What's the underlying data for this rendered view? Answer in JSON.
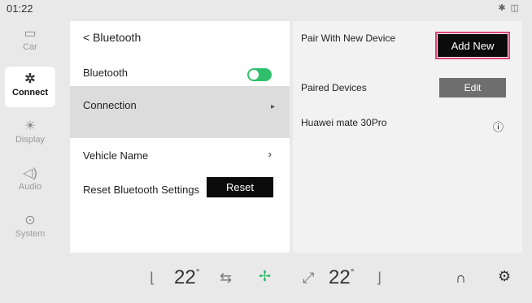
{
  "status": {
    "time": "01:22"
  },
  "sidebar": {
    "items": [
      {
        "label": "Car",
        "icon": "car-icon"
      },
      {
        "label": "Connect",
        "icon": "connect-icon"
      },
      {
        "label": "Display",
        "icon": "brightness-icon"
      },
      {
        "label": "Audio",
        "icon": "speaker-icon"
      },
      {
        "label": "System",
        "icon": "system-icon"
      }
    ]
  },
  "bluetooth_panel": {
    "back_label": "<  Bluetooth",
    "bluetooth_label": "Bluetooth",
    "bluetooth_on": true,
    "connection_label": "Connection",
    "vehicle_name_label": "Vehicle Name",
    "reset_label": "Reset Bluetooth Settings",
    "reset_button": "Reset"
  },
  "devices_panel": {
    "pair_label": "Pair With New Device",
    "add_new_button": "Add New",
    "paired_label": "Paired Devices",
    "edit_button": "Edit",
    "device_name": "Huawei mate 30Pro"
  },
  "climate": {
    "driver_temp": "22",
    "passenger_temp": "22",
    "degree_symbol": "°",
    "accent_fan": "#2fbf6c"
  }
}
